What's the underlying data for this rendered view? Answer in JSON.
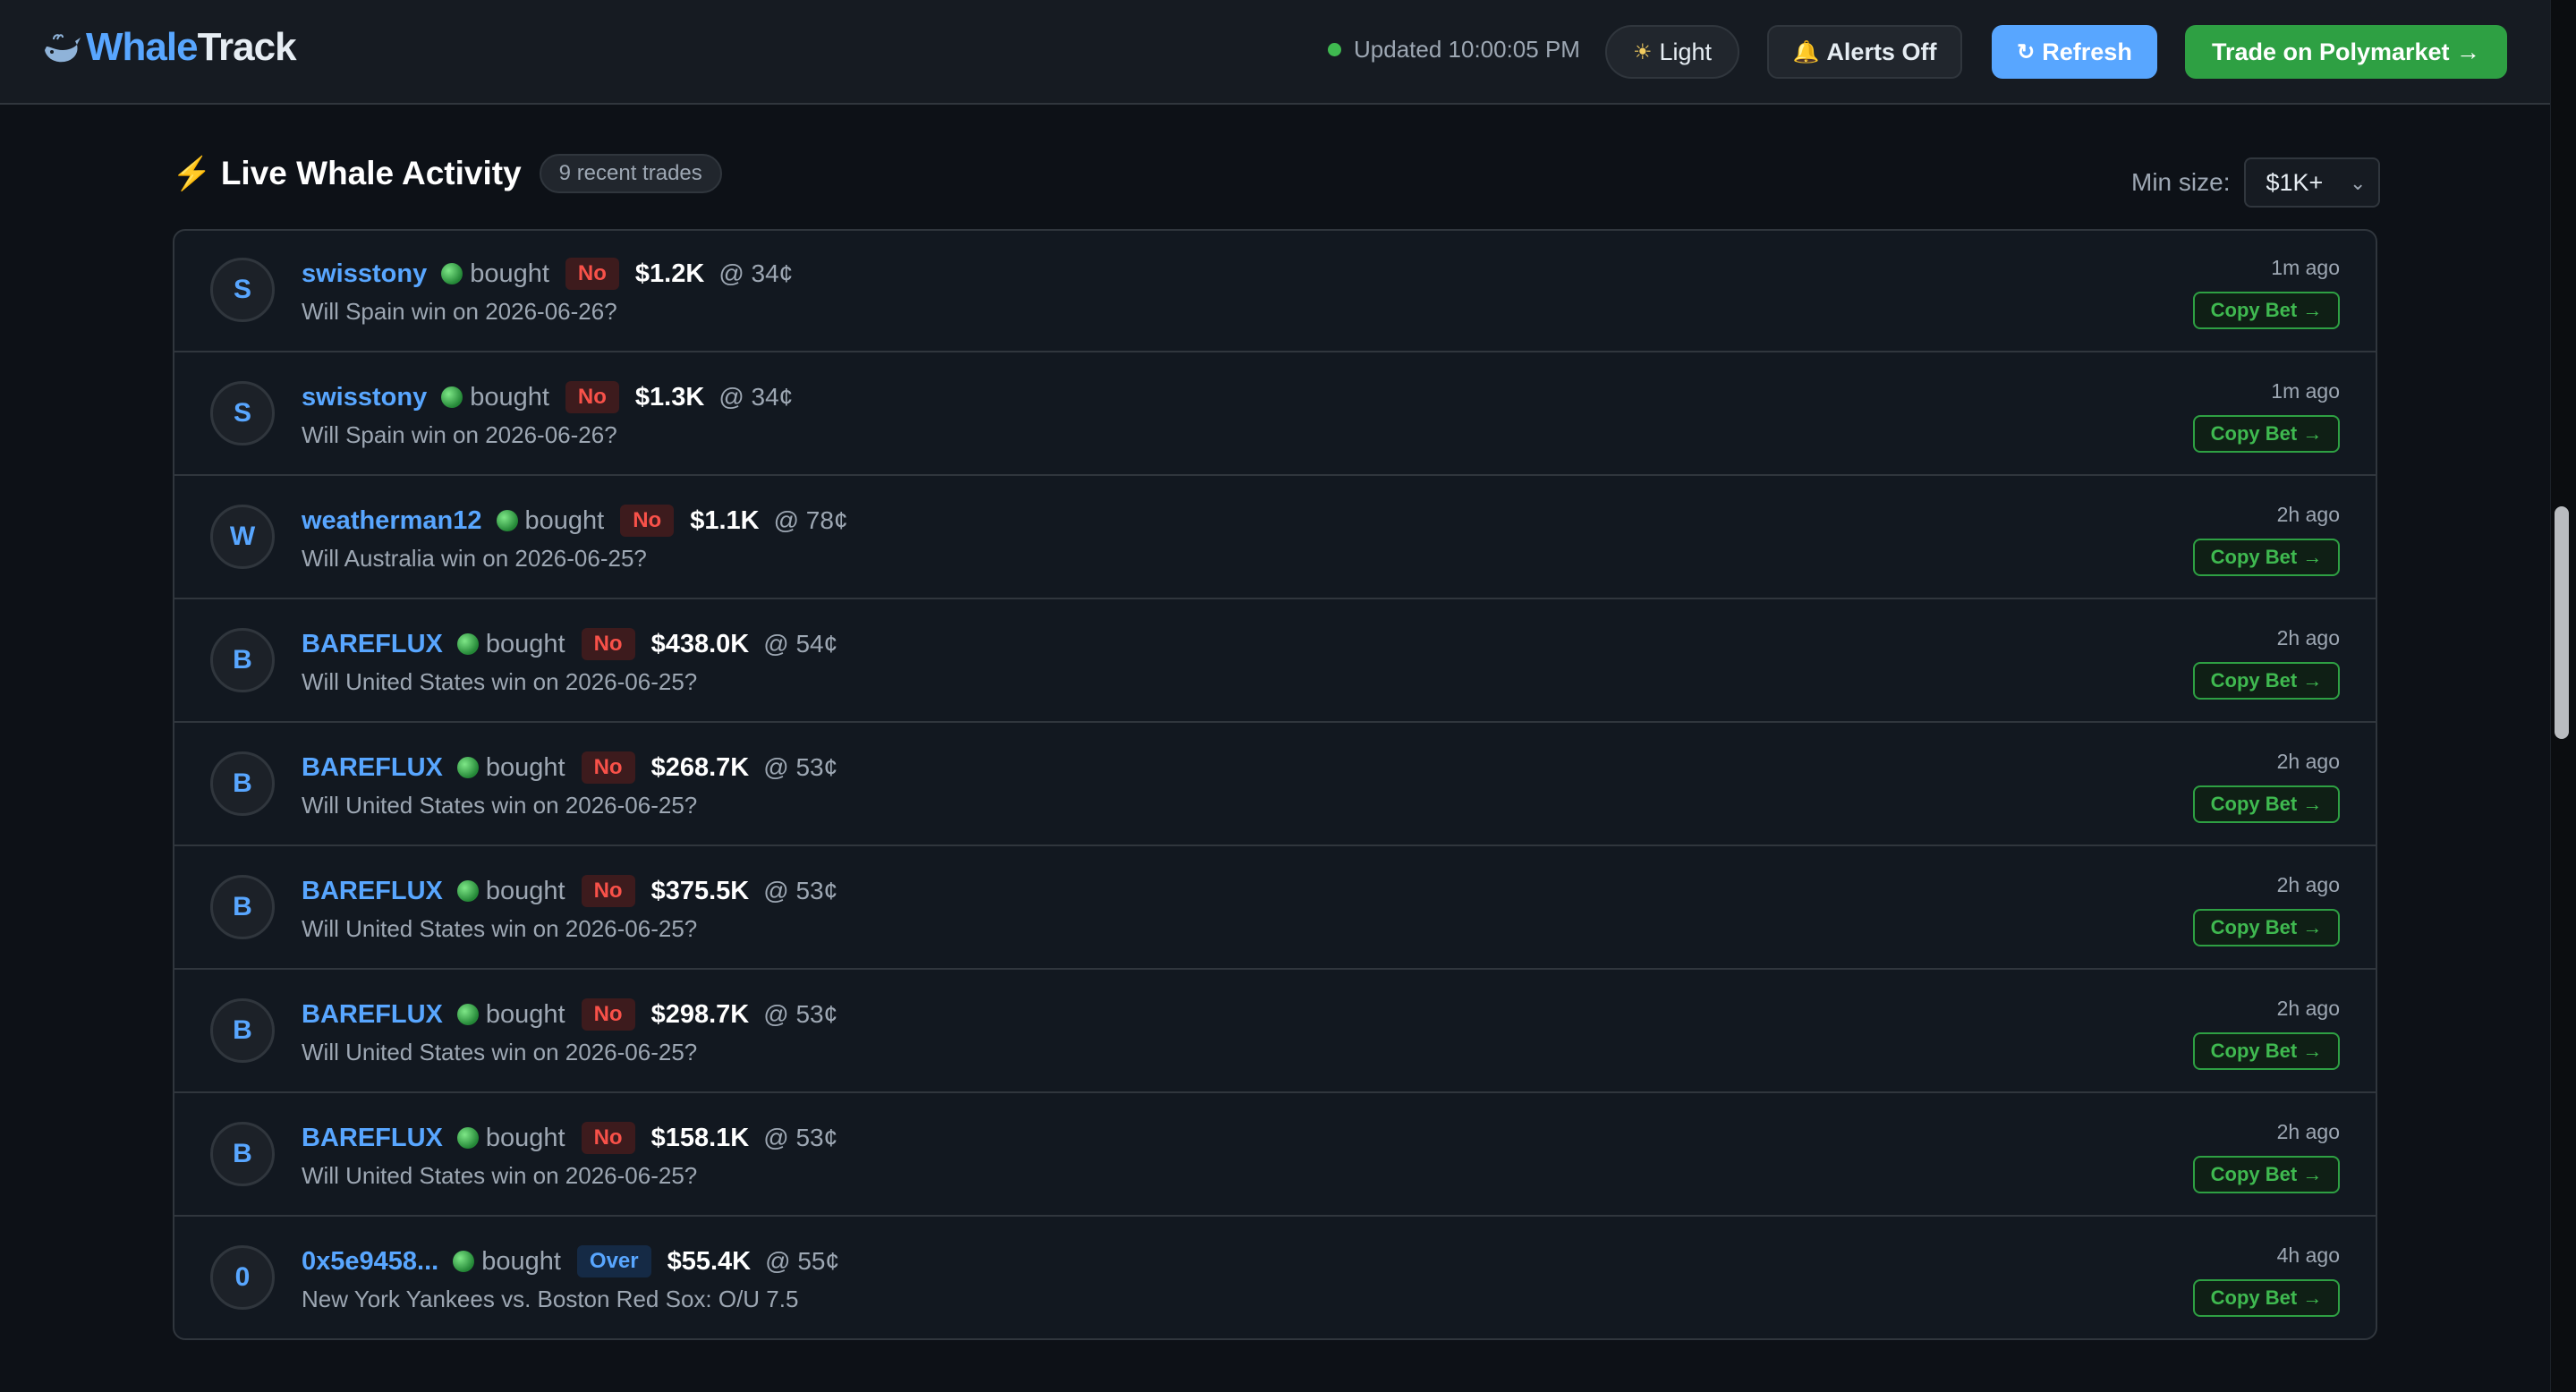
{
  "header": {
    "brand_first": "Whale",
    "brand_second": "Track",
    "updated_text": "Updated 10:00:05 PM",
    "light_label": "Light",
    "alerts_label": "Alerts Off",
    "refresh_label": "Refresh",
    "trade_label": "Trade on Polymarket →"
  },
  "section": {
    "title": "Live Whale Activity",
    "count_badge": "9 recent trades",
    "min_size_label": "Min size:",
    "min_size_value": "$1K+"
  },
  "copy_label": "Copy Bet →",
  "trades": [
    {
      "avatar": "S",
      "user": "swisstony",
      "action": "bought",
      "side": "No",
      "amount": "$1.2K",
      "price": "@ 34¢",
      "market": "Will Spain win on 2026-06-26?",
      "time": "1m ago"
    },
    {
      "avatar": "S",
      "user": "swisstony",
      "action": "bought",
      "side": "No",
      "amount": "$1.3K",
      "price": "@ 34¢",
      "market": "Will Spain win on 2026-06-26?",
      "time": "1m ago"
    },
    {
      "avatar": "W",
      "user": "weatherman12",
      "action": "bought",
      "side": "No",
      "amount": "$1.1K",
      "price": "@ 78¢",
      "market": "Will Australia win on 2026-06-25?",
      "time": "2h ago"
    },
    {
      "avatar": "B",
      "user": "BAREFLUX",
      "action": "bought",
      "side": "No",
      "amount": "$438.0K",
      "price": "@ 54¢",
      "market": "Will United States win on 2026-06-25?",
      "time": "2h ago"
    },
    {
      "avatar": "B",
      "user": "BAREFLUX",
      "action": "bought",
      "side": "No",
      "amount": "$268.7K",
      "price": "@ 53¢",
      "market": "Will United States win on 2026-06-25?",
      "time": "2h ago"
    },
    {
      "avatar": "B",
      "user": "BAREFLUX",
      "action": "bought",
      "side": "No",
      "amount": "$375.5K",
      "price": "@ 53¢",
      "market": "Will United States win on 2026-06-25?",
      "time": "2h ago"
    },
    {
      "avatar": "B",
      "user": "BAREFLUX",
      "action": "bought",
      "side": "No",
      "amount": "$298.7K",
      "price": "@ 53¢",
      "market": "Will United States win on 2026-06-25?",
      "time": "2h ago"
    },
    {
      "avatar": "B",
      "user": "BAREFLUX",
      "action": "bought",
      "side": "No",
      "amount": "$158.1K",
      "price": "@ 53¢",
      "market": "Will United States win on 2026-06-25?",
      "time": "2h ago"
    },
    {
      "avatar": "0",
      "user": "0x5e9458...",
      "action": "bought",
      "side": "Over",
      "amount": "$55.4K",
      "price": "@ 55¢",
      "market": "New York Yankees vs. Boston Red Sox: O/U 7.5",
      "time": "4h ago"
    }
  ]
}
